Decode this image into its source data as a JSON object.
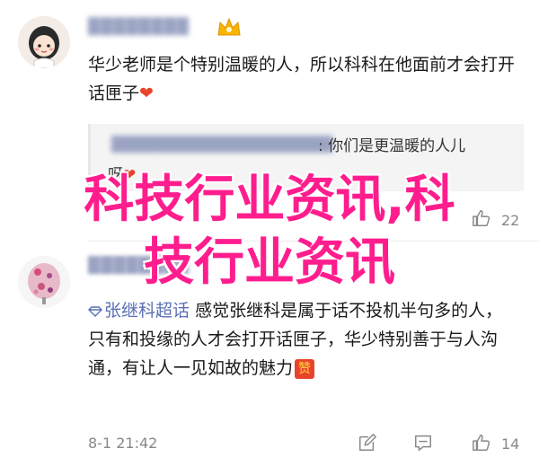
{
  "comment1": {
    "username": "████████",
    "text": "华少老师是个特别温暖的人，所以科科在他面前才会打开话匣子",
    "heart": "❤",
    "quote": {
      "username": "████████████████████",
      "text_part1": ": 你们是更温暖的人儿",
      "text_part2": "呀"
    },
    "time": "",
    "likes": "22"
  },
  "comment2": {
    "username": "████████",
    "topic": "张继科超话",
    "text": "感觉张继科是属于话不投机半句多的人，只有和投缘的人才会打开话匣子，华少特别善于与人沟通，有让人一见如故的魅力",
    "emoji_label": "赞",
    "time": "8-1 21:42",
    "likes": "14"
  },
  "watermark": {
    "line1": "科技行业资讯,科",
    "line2": "技行业资讯"
  },
  "colors": {
    "watermark": "#ff1d8e",
    "link": "#5a6fb4",
    "heart": "#e8442c"
  }
}
